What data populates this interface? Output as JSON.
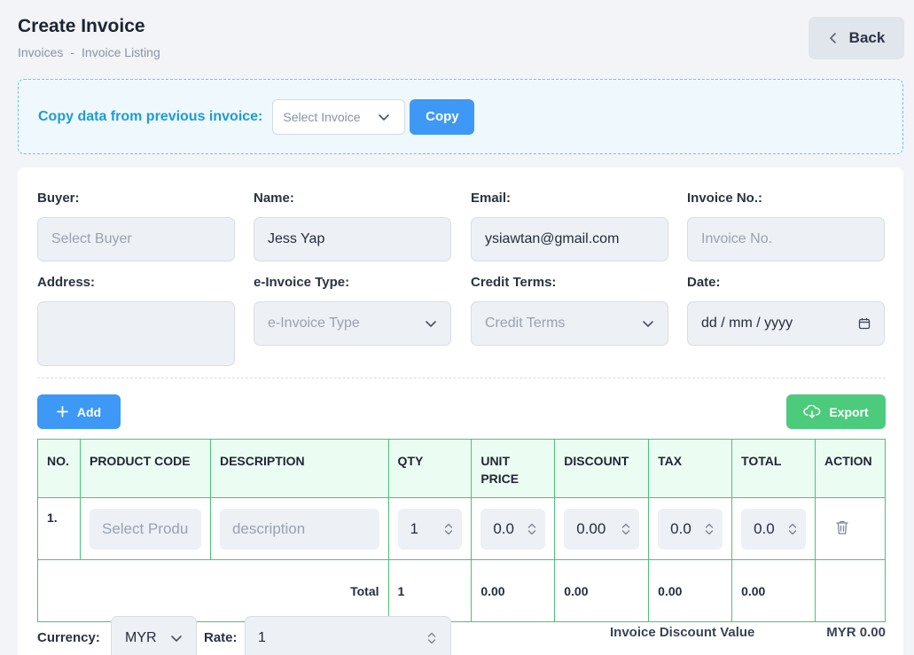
{
  "header": {
    "title": "Create Invoice",
    "breadcrumb": [
      "Invoices",
      "-",
      "Invoice Listing"
    ],
    "back_label": "Back"
  },
  "copy_panel": {
    "label": "Copy data from previous invoice:",
    "select_placeholder": "Select Invoice",
    "copy_label": "Copy"
  },
  "form": {
    "buyer": {
      "label": "Buyer:",
      "placeholder": "Select Buyer"
    },
    "name": {
      "label": "Name:",
      "value": "Jess Yap"
    },
    "email": {
      "label": "Email:",
      "value": "ysiawtan@gmail.com"
    },
    "invoice_no": {
      "label": "Invoice No.:",
      "placeholder": "Invoice No."
    },
    "address": {
      "label": "Address:",
      "value": ""
    },
    "einvoice_type": {
      "label": "e-Invoice Type:",
      "placeholder": "e-Invoice Type"
    },
    "credit_terms": {
      "label": "Credit Terms:",
      "placeholder": "Credit Terms"
    },
    "date": {
      "label": "Date:",
      "placeholder": "dd / mm / yyyy"
    }
  },
  "toolbar": {
    "add_label": "Add",
    "export_label": "Export"
  },
  "table": {
    "headers": [
      "NO.",
      "PRODUCT CODE",
      "DESCRIPTION",
      "QTY",
      "UNIT PRICE",
      "DISCOUNT",
      "TAX",
      "TOTAL",
      "ACTION"
    ],
    "rows": [
      {
        "no": "1.",
        "product_placeholder": "Select Produ",
        "description_placeholder": "description",
        "qty": "1",
        "unit_price": "0.0",
        "discount": "0.00",
        "tax": "0.0",
        "total": "0.0"
      }
    ],
    "totals": {
      "label": "Total",
      "qty": "1",
      "unit_price": "0.00",
      "discount": "0.00",
      "tax": "0.00",
      "total": "0.00"
    }
  },
  "bottom": {
    "currency_label": "Currency:",
    "currency_value": "MYR",
    "rate_label": "Rate:",
    "rate_value": "1",
    "invoice_discount_label": "Invoice Discount Value",
    "invoice_discount_value": "MYR 0.00"
  },
  "colors": {
    "primary": "#3d99f5",
    "success": "#4ccb7d",
    "table_border": "#4cc17a",
    "copy_label": "#1f9bd6"
  }
}
